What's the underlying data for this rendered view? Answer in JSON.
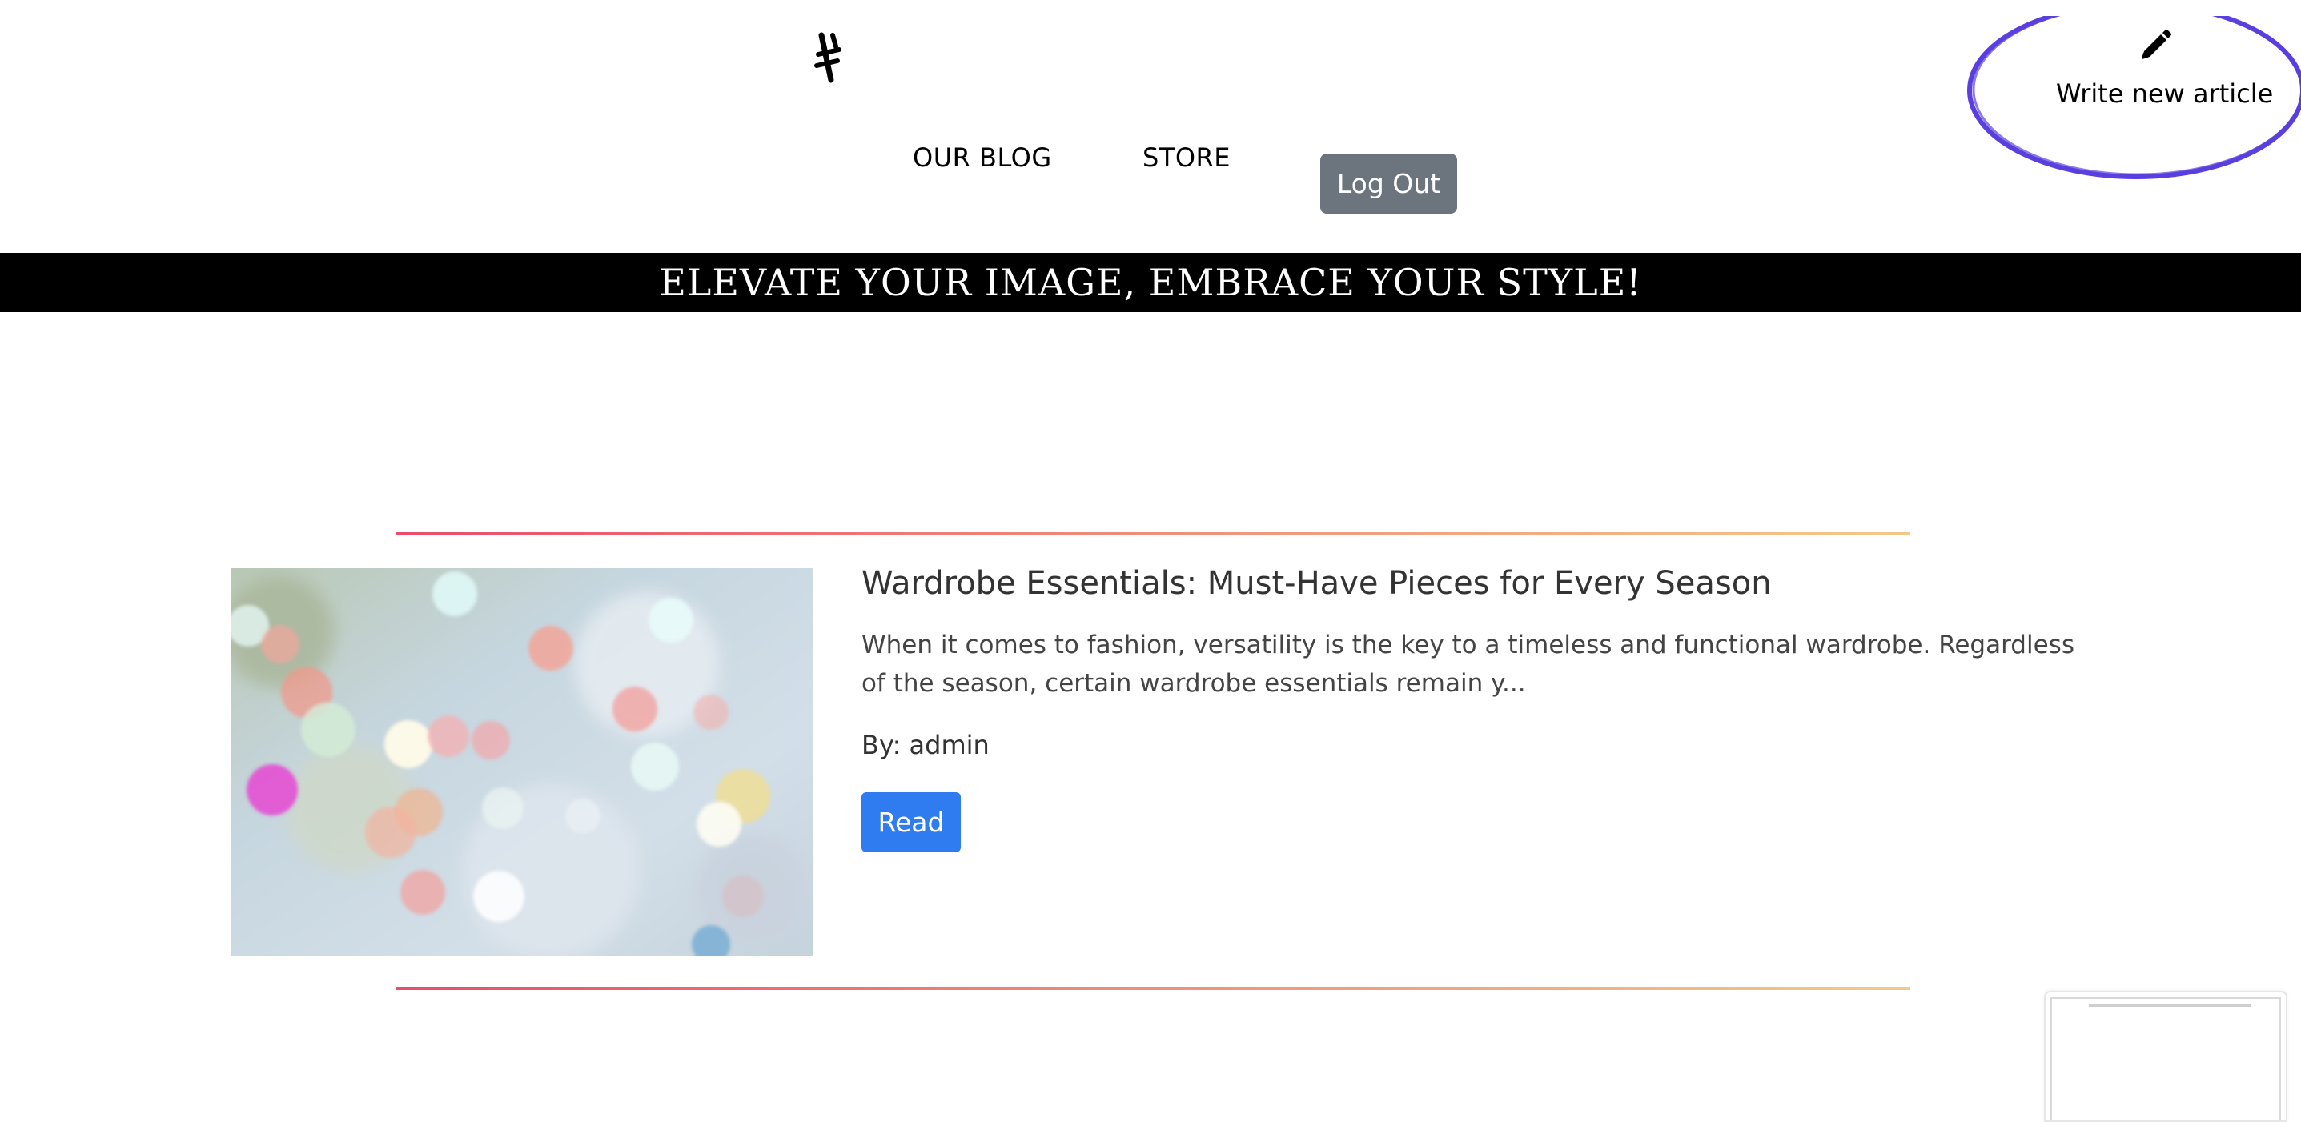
{
  "header": {
    "logo_icon": "hash-logo-icon",
    "nav": [
      {
        "label": "OUR BLOG"
      },
      {
        "label": "STORE"
      }
    ],
    "logout_label": "Log Out",
    "write_article": {
      "label": "Write new article",
      "icon": "pencil-icon",
      "annotation_color": "#5a3fe0"
    }
  },
  "banner": {
    "text": "ELEVATE YOUR IMAGE, EMBRACE YOUR STYLE!"
  },
  "article": {
    "title": "Wardrobe Essentials: Must-Have Pieces for Every Season",
    "excerpt": "When it comes to fashion, versatility is the key to a timeless and functional wardrobe. Regardless of the season, certain wardrobe essentials remain y...",
    "author": "By: admin",
    "read_label": "Read"
  },
  "colors": {
    "logout_bg": "#6c757d",
    "read_bg": "#2f7bf0",
    "banner_bg": "#000000",
    "divider_start": "#e84d6b",
    "divider_end": "#f2c98a"
  }
}
